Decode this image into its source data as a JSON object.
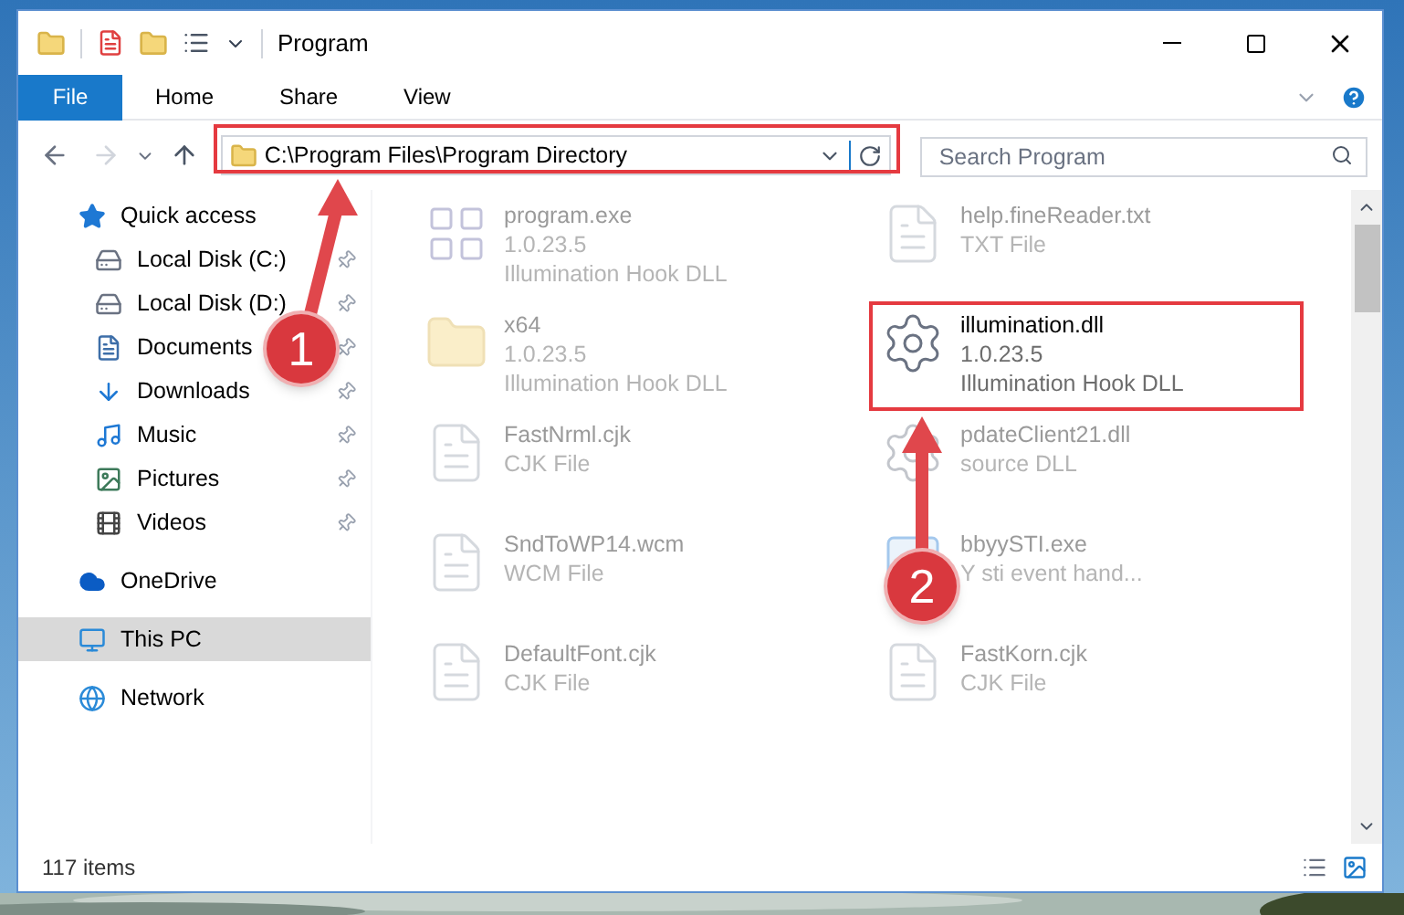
{
  "window": {
    "title": "Program"
  },
  "ribbon_tabs": [
    {
      "label": "File",
      "selected": true
    },
    {
      "label": "Home",
      "selected": false
    },
    {
      "label": "Share",
      "selected": false
    },
    {
      "label": "View",
      "selected": false
    }
  ],
  "address_bar": {
    "path": "C:\\Program Files\\Program Directory"
  },
  "search": {
    "placeholder": "Search Program"
  },
  "navigation": [
    {
      "label": "Quick access",
      "selected": false,
      "children": [
        {
          "label": "Local Disk (C:)",
          "pinned": true,
          "selected": false
        },
        {
          "label": "Local Disk (D:)",
          "pinned": true,
          "selected": false
        },
        {
          "label": "Documents",
          "pinned": true,
          "selected": false
        },
        {
          "label": "Downloads",
          "pinned": true,
          "selected": false
        },
        {
          "label": "Music",
          "pinned": true,
          "selected": false
        },
        {
          "label": "Pictures",
          "pinned": true,
          "selected": false
        },
        {
          "label": "Videos",
          "pinned": true,
          "selected": false
        }
      ]
    },
    {
      "label": "OneDrive",
      "selected": false
    },
    {
      "label": "This PC",
      "selected": true
    },
    {
      "label": "Network",
      "selected": false
    }
  ],
  "files": [
    {
      "kind": "app",
      "name": "program.exe",
      "details": [
        "1.0.23.5",
        "Illumination Hook DLL"
      ],
      "dimmed": true
    },
    {
      "kind": "document",
      "name": "help.fineReader.txt",
      "details": [
        "TXT File"
      ],
      "dimmed": true
    },
    {
      "kind": "folder",
      "name": "x64",
      "details": [
        "1.0.23.5",
        "Illumination Hook DLL"
      ],
      "dimmed": true
    },
    {
      "kind": "dll",
      "name": "illumination.dll",
      "details": [
        "1.0.23.5",
        "Illumination Hook DLL"
      ],
      "dimmed": false
    },
    {
      "kind": "document",
      "name": "FastNrml.cjk",
      "details": [
        "CJK File"
      ],
      "dimmed": true
    },
    {
      "kind": "dll",
      "name": "pdateClient21.dll",
      "details": [
        "source DLL"
      ],
      "dimmed": true
    },
    {
      "kind": "document",
      "name": "SndToWP14.wcm",
      "details": [
        "WCM File"
      ],
      "dimmed": true
    },
    {
      "kind": "window",
      "name": "bbyySTI.exe",
      "details": [
        "Y sti event hand..."
      ],
      "dimmed": true
    },
    {
      "kind": "document",
      "name": "DefaultFont.cjk",
      "details": [
        "CJK File"
      ],
      "dimmed": true
    },
    {
      "kind": "document",
      "name": "FastKorn.cjk",
      "details": [
        "CJK File"
      ],
      "dimmed": true
    }
  ],
  "status_bar": {
    "item_count": "117 items"
  },
  "callouts": [
    {
      "number": "1"
    },
    {
      "number": "2"
    }
  ]
}
